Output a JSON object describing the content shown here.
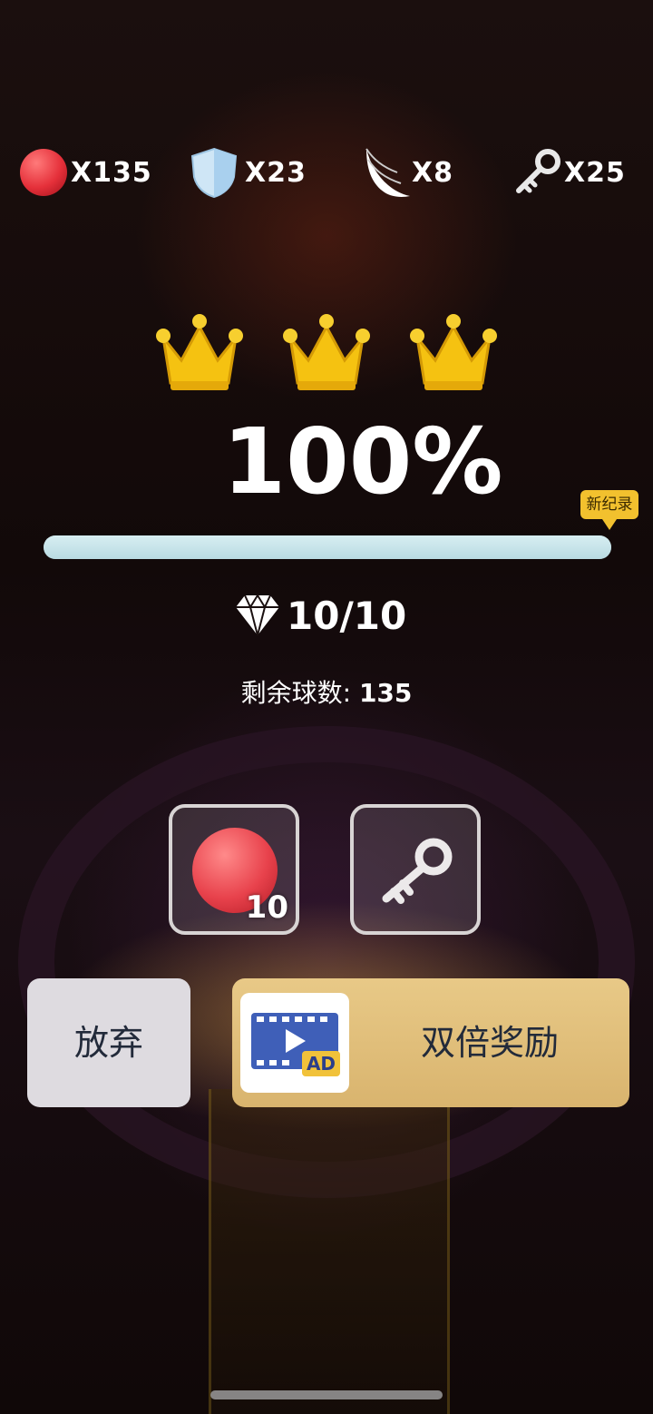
{
  "resources": [
    {
      "icon": "red-ball-icon",
      "label": "X135"
    },
    {
      "icon": "shield-icon",
      "label": "X23"
    },
    {
      "icon": "wing-icon",
      "label": "X8"
    },
    {
      "icon": "key-icon",
      "label": "X25"
    }
  ],
  "result": {
    "crowns": 3,
    "percent_text": "100%",
    "progress": 1.0,
    "record_badge": "新纪录",
    "gems": "10/10",
    "remaining_label": "剩余球数:",
    "remaining_value": "135"
  },
  "rewards": {
    "ball_count": "10"
  },
  "buttons": {
    "give_up": "放弃",
    "double_reward": "双倍奖励",
    "ad_tag": "AD"
  },
  "colors": {
    "crown": "#f5c211",
    "progress_fill": "#c9e6eb",
    "double_button": "#e0bf7c"
  }
}
